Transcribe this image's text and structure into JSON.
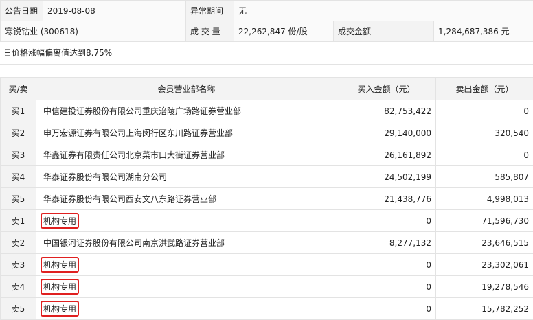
{
  "info": {
    "row1": {
      "date_label": "公告日期",
      "date_value": "2019-08-08",
      "period_label": "异常期间",
      "period_value": "无"
    },
    "row2": {
      "stock_name": "寒锐钴业 (300618)",
      "volume_label": "成 交 量",
      "volume_value": "22,262,847 份/股",
      "amount_label": "成交金额",
      "amount_value": "1,284,687,386 元"
    }
  },
  "note": "日价格涨幅偏离值达到8.75%",
  "trade_table": {
    "headers": {
      "side": "买/卖",
      "name": "会员营业部名称",
      "buy": "买入金额（元）",
      "sell": "卖出金额（元）"
    },
    "rows": [
      {
        "side": "买1",
        "name": "中信建投证券股份有限公司重庆涪陵广场路证券营业部",
        "buy": "82,753,422",
        "sell": "0",
        "highlight": false
      },
      {
        "side": "买2",
        "name": "申万宏源证券有限公司上海闵行区东川路证券营业部",
        "buy": "29,140,000",
        "sell": "320,540",
        "highlight": false
      },
      {
        "side": "买3",
        "name": "华鑫证券有限责任公司北京菜市口大街证券营业部",
        "buy": "26,161,892",
        "sell": "0",
        "highlight": false
      },
      {
        "side": "买4",
        "name": "华泰证券股份有限公司湖南分公司",
        "buy": "24,502,199",
        "sell": "585,807",
        "highlight": false
      },
      {
        "side": "买5",
        "name": "华泰证券股份有限公司西安文八东路证券营业部",
        "buy": "21,438,776",
        "sell": "4,998,013",
        "highlight": false
      },
      {
        "side": "卖1",
        "name": "机构专用",
        "buy": "0",
        "sell": "71,596,730",
        "highlight": true
      },
      {
        "side": "卖2",
        "name": "中国银河证券股份有限公司南京洪武路证券营业部",
        "buy": "8,277,132",
        "sell": "23,646,515",
        "highlight": false
      },
      {
        "side": "卖3",
        "name": "机构专用",
        "buy": "0",
        "sell": "23,302,061",
        "highlight": true
      },
      {
        "side": "卖4",
        "name": "机构专用",
        "buy": "0",
        "sell": "19,278,546",
        "highlight": true
      },
      {
        "side": "卖5",
        "name": "机构专用",
        "buy": "0",
        "sell": "15,782,252",
        "highlight": true
      }
    ]
  },
  "colors": {
    "highlight_border": "#e02020",
    "header_bg": "#f3f3f3",
    "grid_line": "#e3e3e3"
  }
}
